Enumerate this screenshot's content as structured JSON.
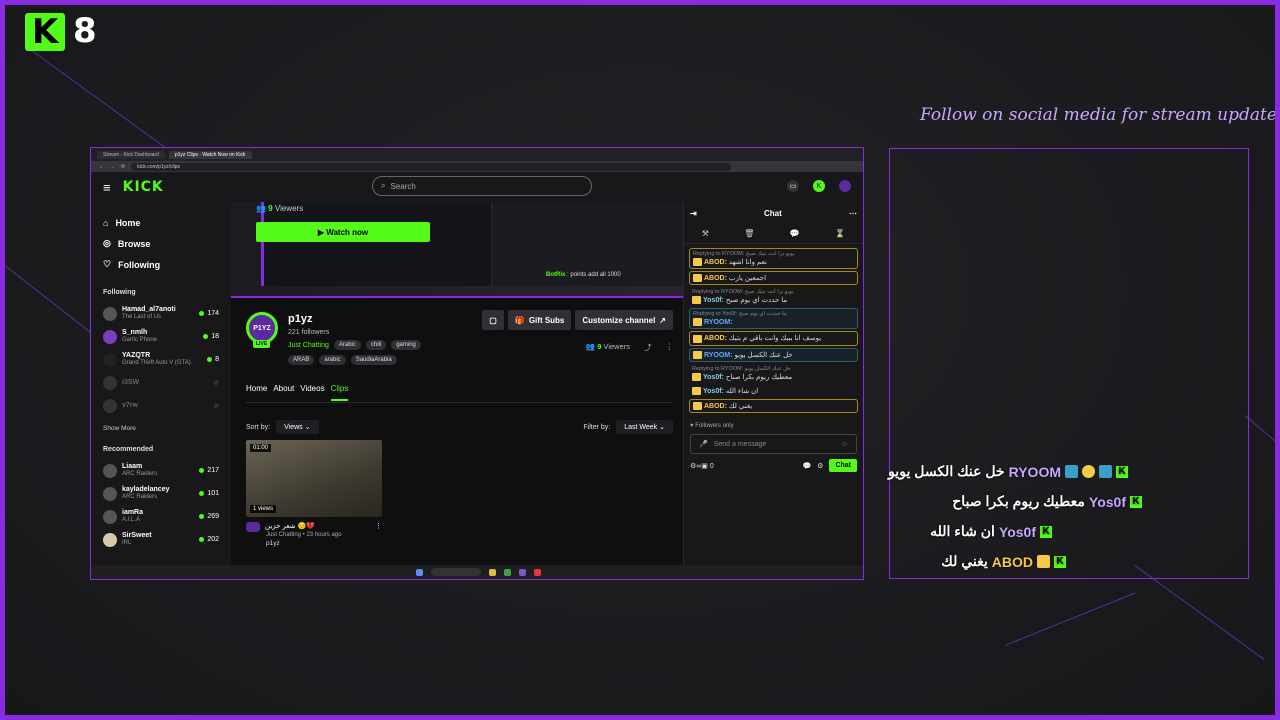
{
  "overlay": {
    "logo_letter": "K",
    "count": "8",
    "follow_note": "Follow on social media for stream updates",
    "messages": [
      {
        "user": "RYOOM",
        "text": "خل عنك الكسل يويو",
        "color": "#c9a6ff"
      },
      {
        "user": "Yos0f",
        "text": "معطيك ريوم بكرا صباح",
        "color": "#c9a6ff"
      },
      {
        "user": "Yos0f",
        "text": "ان شاء الله",
        "color": "#c9a6ff"
      },
      {
        "user": "ABOD",
        "text": "يغني لك",
        "color": "#f7c948"
      }
    ]
  },
  "browser": {
    "tabs": [
      "Stream - Kick Dashboard",
      "p1yz Clips - Watch Now on Kick"
    ],
    "url": "kick.com/p1yz/clips",
    "brand": "KICK",
    "search_placeholder": "Search",
    "nav": [
      {
        "label": "Home",
        "icon": "home-icon"
      },
      {
        "label": "Browse",
        "icon": "compass-icon"
      },
      {
        "label": "Following",
        "icon": "heart-icon"
      }
    ],
    "following_title": "Following",
    "following": [
      {
        "name": "Hamad_al7anoti",
        "game": "The Last of Us",
        "viewers": "174",
        "online": true
      },
      {
        "name": "S_nmlh",
        "game": "Gartic Phone",
        "viewers": "18",
        "online": true
      },
      {
        "name": "YAZQTR",
        "game": "Grand Theft Auto V (GTA)",
        "viewers": "8",
        "online": true
      },
      {
        "name": "i3SW",
        "game": "",
        "viewers": "",
        "online": false
      },
      {
        "name": "v7rw",
        "game": "",
        "viewers": "",
        "online": false
      }
    ],
    "show_more": "Show More",
    "recommended_title": "Recommended",
    "recommended": [
      {
        "name": "Liaam",
        "game": "ARC Raiders",
        "viewers": "217"
      },
      {
        "name": "kayladelancey",
        "game": "ARC Raiders",
        "viewers": "101"
      },
      {
        "name": "iamRa",
        "game": "A.I.L.A",
        "viewers": "269"
      },
      {
        "name": "SirSweet",
        "game": "IRL",
        "viewers": "202"
      }
    ],
    "hero": {
      "viewers_count": "9",
      "viewers_label": "Viewers",
      "watch_now": "Watch now",
      "bot_name": "BotRix",
      "bot_text": "points add all 1000"
    },
    "channel": {
      "name": "p1yz",
      "avatar_text": "P1YZ",
      "live": "LIVE",
      "followers": "221 followers",
      "category": "Just Chatting",
      "tags1": [
        "Arabic",
        "chill",
        "gaming"
      ],
      "tags2": [
        "ARAB",
        "arabic",
        "SaudiaArabia"
      ],
      "gift_subs": "Gift Subs",
      "customize": "Customize channel",
      "viewers_count": "9",
      "viewers_label": "Viewers"
    },
    "tabs_main": [
      "Home",
      "About",
      "Videos",
      "Clips"
    ],
    "active_tab": "Clips",
    "sort_label": "Sort by:",
    "sort_value": "Views",
    "filter_label": "Filter by:",
    "filter_value": "Last Week",
    "clip": {
      "duration": "01:00",
      "views": "1 views",
      "title": "شعر حزين 😔💔",
      "meta": "Just Chatting • 23 hours ago",
      "user": "p1yz"
    },
    "chat": {
      "title": "Chat",
      "messages": [
        {
          "reply": "Replying to RYOOM: يويو ترا انت بتيك صبح",
          "user": "ABOD",
          "text": "نعم وانا اشهد",
          "style": "box",
          "ucolor": "u-gold"
        },
        {
          "reply": "",
          "user": "ABOD",
          "text": "اجمعين يارب",
          "style": "box",
          "ucolor": "u-gold"
        },
        {
          "reply": "Replying to RYOOM: يويو ترا انت بتيك صبح",
          "user": "Yos0f",
          "text": "ما حددت اي يوم صبح",
          "style": "",
          "ucolor": "u-cyan"
        },
        {
          "reply": "Replying to Yos0f: ما حددت اي يوم صبح",
          "user": "RYOOM",
          "text": "",
          "style": "boxc",
          "ucolor": "u-blue"
        },
        {
          "reply": "",
          "user": "ABOD",
          "text": "يوسف انا بيبك وانت باقي م بتيك",
          "style": "box",
          "ucolor": "u-gold"
        },
        {
          "reply": "",
          "user": "RYOOM",
          "text": "خل عنك الكسل يويو",
          "style": "boxc",
          "ucolor": "u-blue"
        },
        {
          "reply": "Replying to RYOOM: خل عنك الكسل يويو",
          "user": "Yos0f",
          "text": "معطيك ريوم بكرا صباح",
          "style": "",
          "ucolor": "u-cyan"
        },
        {
          "reply": "",
          "user": "Yos0f",
          "text": "ان شاء الله",
          "style": "",
          "ucolor": "u-cyan"
        },
        {
          "reply": "",
          "user": "ABOD",
          "text": "يغني لك",
          "style": "box",
          "ucolor": "u-gold"
        }
      ],
      "followers_only": "Followers only",
      "input_placeholder": "Send a message",
      "points": "0",
      "send": "Chat"
    },
    "taskbar_search": "Search"
  }
}
